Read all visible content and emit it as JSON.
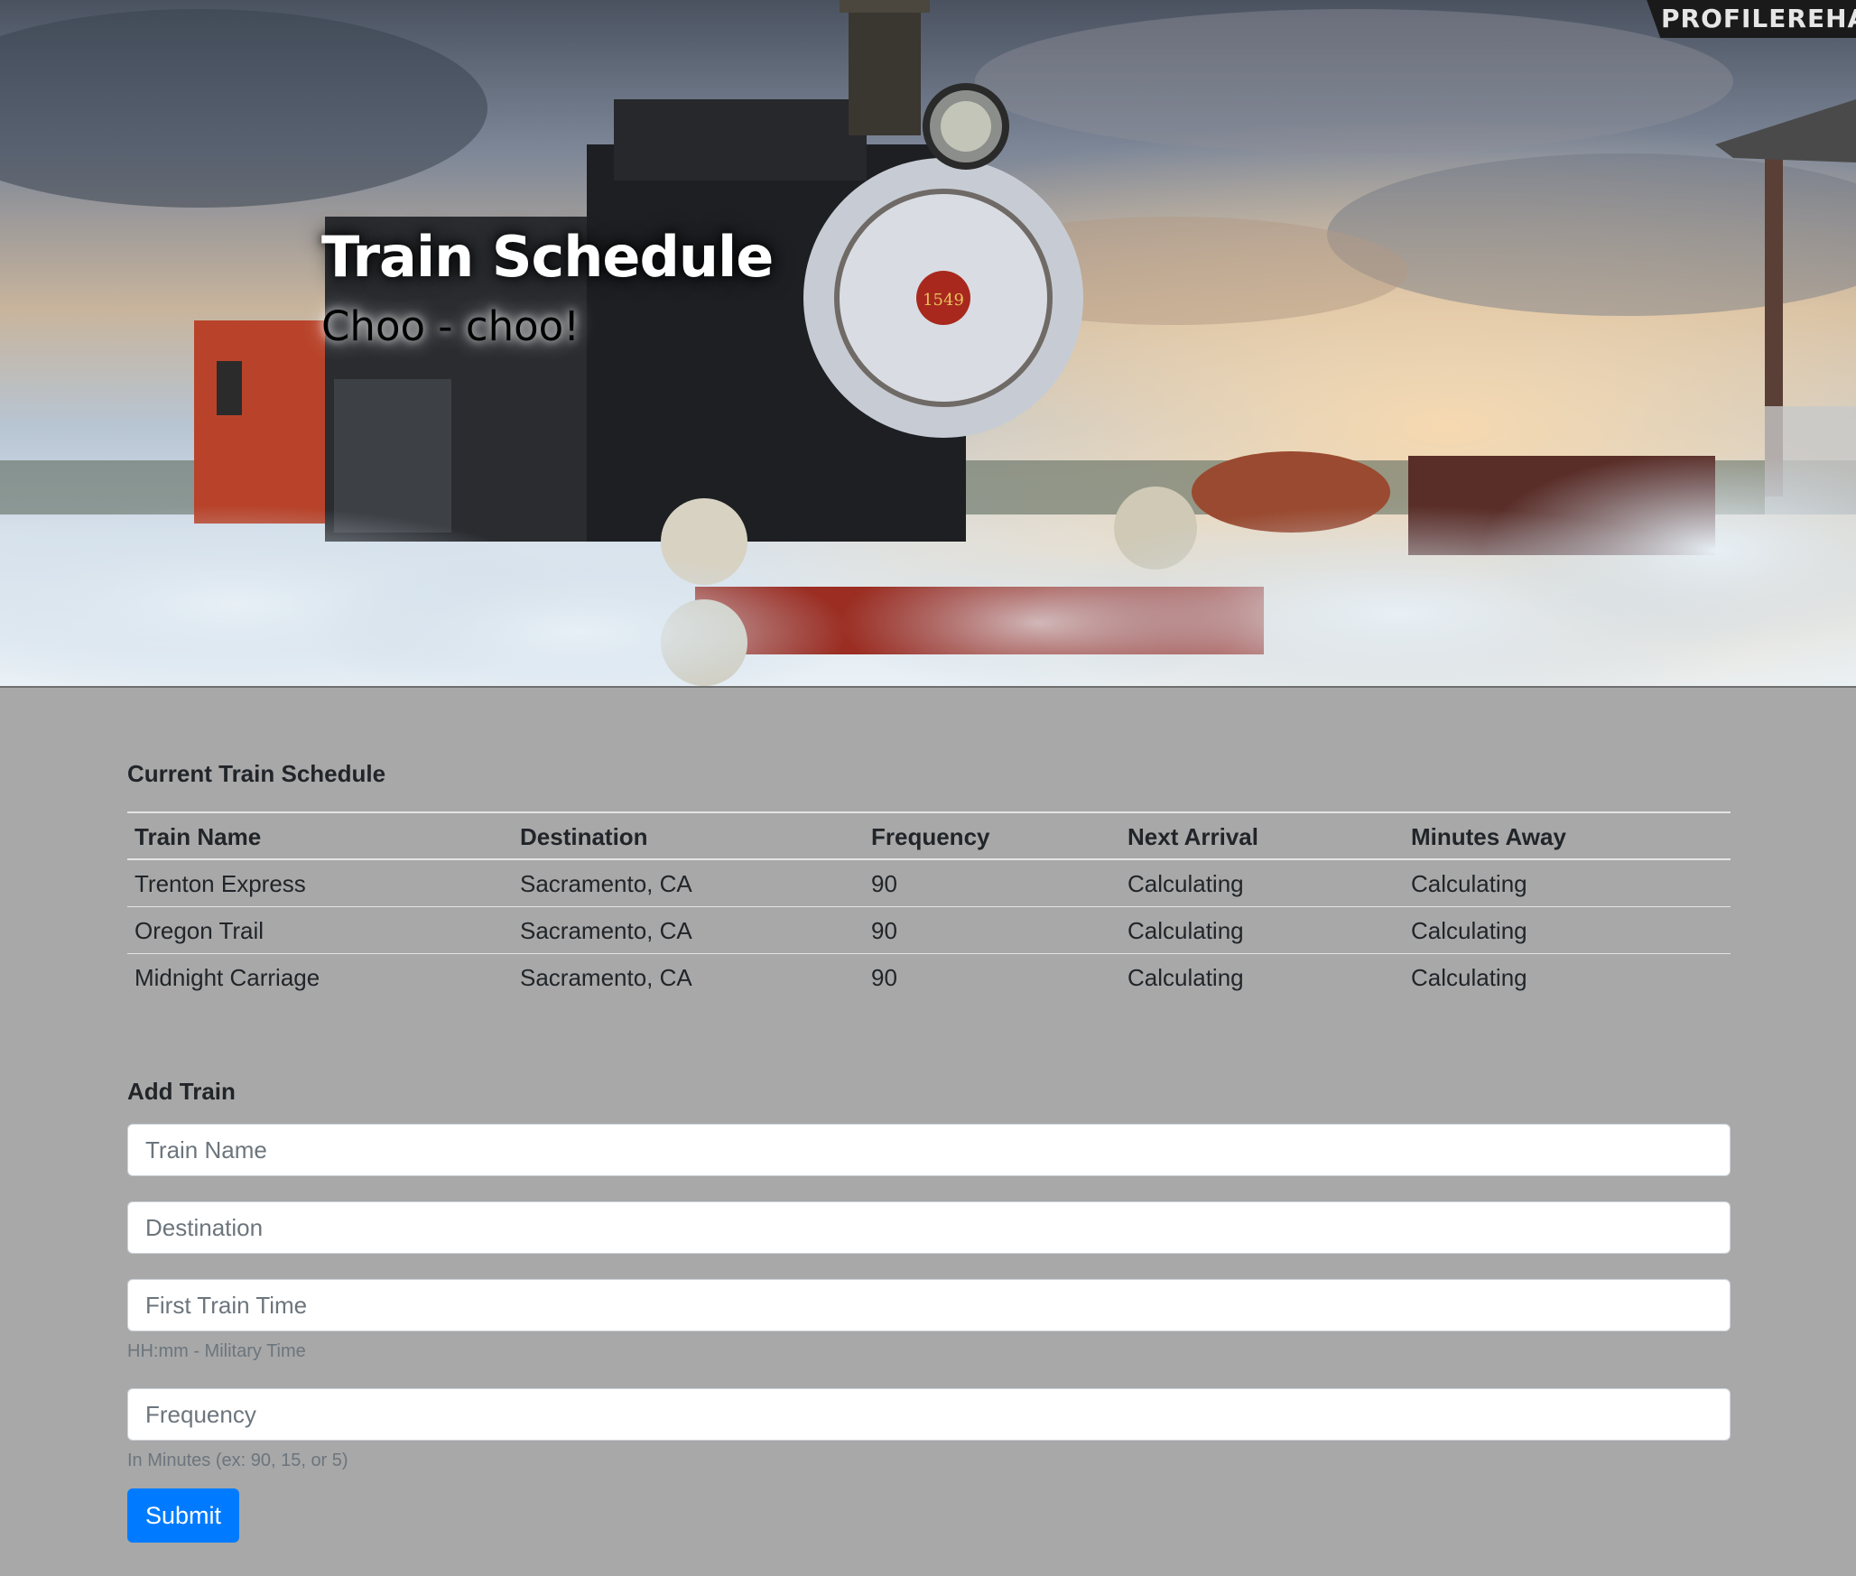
{
  "hero": {
    "title": "Train Schedule",
    "subtitle": "Choo - choo!",
    "watermark": "PROFILEREHAB",
    "locomotive_number": "1549"
  },
  "schedule": {
    "title": "Current Train Schedule",
    "columns": [
      "Train Name",
      "Destination",
      "Frequency",
      "Next Arrival",
      "Minutes Away"
    ],
    "rows": [
      [
        "Trenton Express",
        "Sacramento, CA",
        "90",
        "Calculating",
        "Calculating"
      ],
      [
        "Oregon Trail",
        "Sacramento, CA",
        "90",
        "Calculating",
        "Calculating"
      ],
      [
        "Midnight Carriage",
        "Sacramento, CA",
        "90",
        "Calculating",
        "Calculating"
      ]
    ]
  },
  "form": {
    "title": "Add Train",
    "train_name_placeholder": "Train Name",
    "destination_placeholder": "Destination",
    "first_time_placeholder": "First Train Time",
    "first_time_help": "HH:mm - Military Time",
    "frequency_placeholder": "Frequency",
    "frequency_help": "In Minutes (ex: 90, 15, or 5)",
    "submit_label": "Submit"
  },
  "colors": {
    "page_background": "#a8a8a8",
    "primary_button": "#007bff",
    "table_rule": "#e4e4e4"
  }
}
